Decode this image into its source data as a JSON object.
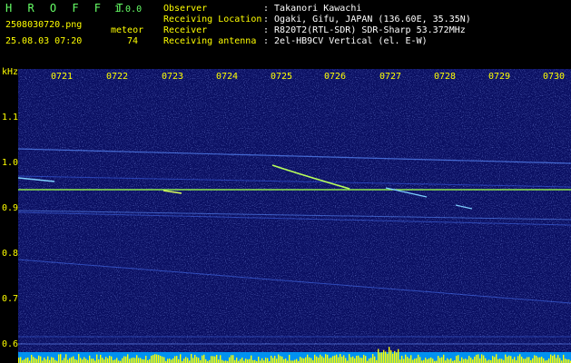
{
  "app": {
    "title": "H R O F F T",
    "version": "1.0.0"
  },
  "capture": {
    "filename": "2508030720.png",
    "datetime": "25.08.03 07:20",
    "meteor_label": "meteor",
    "meteor_count": "74"
  },
  "info": [
    {
      "label": "Observer",
      "value": ": Takanori Kawachi"
    },
    {
      "label": "Receiving Location",
      "value": ": Ogaki, Gifu, JAPAN (136.60E, 35.35N)"
    },
    {
      "label": "Receiver",
      "value": ": R820T2(RTL-SDR) SDR-Sharp 53.372MHz"
    },
    {
      "label": "Receiving antenna",
      "value": ": 2el-HB9CV Vertical (el. E-W)"
    }
  ],
  "spectrogram": {
    "y_unit": "kHz",
    "y_ticks": [
      "1.1",
      "1.0",
      "0.9",
      "0.8",
      "0.7",
      "0.6"
    ],
    "x_ticks": [
      "0721",
      "0722",
      "0723",
      "0724",
      "0725",
      "0726",
      "0727",
      "0728",
      "0729",
      "0730"
    ],
    "colors": {
      "background": "#0a0f62",
      "noise": "#2b3db8",
      "trace": "#7fd0ff",
      "strong": "#c8ff4a",
      "activity": "#ffff00"
    }
  }
}
